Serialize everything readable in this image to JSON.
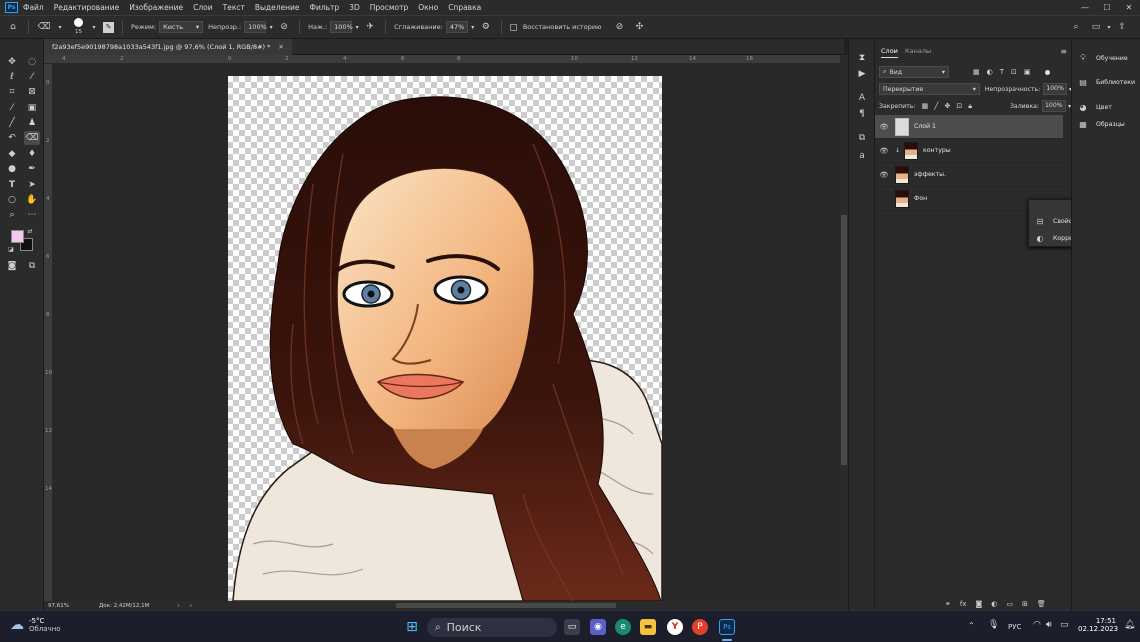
{
  "menubar": {
    "logo": "Ps",
    "items": [
      "Файл",
      "Редактирование",
      "Изображение",
      "Слои",
      "Текст",
      "Выделение",
      "Фильтр",
      "3D",
      "Просмотр",
      "Окно",
      "Справка"
    ],
    "win_min": "—",
    "win_max": "☐",
    "win_close": "✕"
  },
  "options": {
    "brush_size": "15",
    "mode_label": "Режим:",
    "mode_value": "Кисть",
    "opacity_label": "Непрозр.:",
    "opacity_value": "100%",
    "flow_label": "Наж.:",
    "flow_value": "100%",
    "smoothing_label": "Сглаживание:",
    "smoothing_value": "47%",
    "history_label": "Восстановить историю"
  },
  "document": {
    "tab_title": "f2a93ef5e90198798a1033a543f1.jpg @ 97,6% (Слой 1, RGB/8#) *",
    "ruler_h": [
      "4",
      "2",
      "0",
      "2",
      "4",
      "6",
      "8",
      "10",
      "12",
      "14",
      "16"
    ],
    "ruler_v": [
      "0",
      "2",
      "4",
      "6",
      "8",
      "10",
      "12",
      "14"
    ],
    "zoom": "97,61%",
    "doc_info": "Док: 2,42M/12,1M"
  },
  "layers_panel": {
    "tab_layers": "Слои",
    "tab_channels": "Каналы",
    "search_label": "Вид",
    "blend_mode": "Перекрытие",
    "opacity_label": "Непрозрачность:",
    "opacity_value": "100%",
    "lock_label": "Закрепить:",
    "fill_label": "Заливка:",
    "fill_value": "100%",
    "layers": [
      {
        "name": "Слой 1"
      },
      {
        "name": "контуры"
      },
      {
        "name": "эффекты."
      },
      {
        "name": "Фон"
      }
    ]
  },
  "float_panel": {
    "properties": "Свойства",
    "adjustments": "Коррекция"
  },
  "right_panel": {
    "items": [
      "Обучение",
      "Библиотеки",
      "Цвет",
      "Образцы"
    ]
  },
  "taskbar": {
    "weather_temp": "-5°C",
    "weather_desc": "Облачно",
    "search": "Поиск",
    "lang": "РУС",
    "time": "17:51",
    "date": "02.12.2023"
  },
  "colors": {
    "foreground": "#f5c8f0",
    "background": "#111111",
    "accent": "#2fa3f5"
  }
}
